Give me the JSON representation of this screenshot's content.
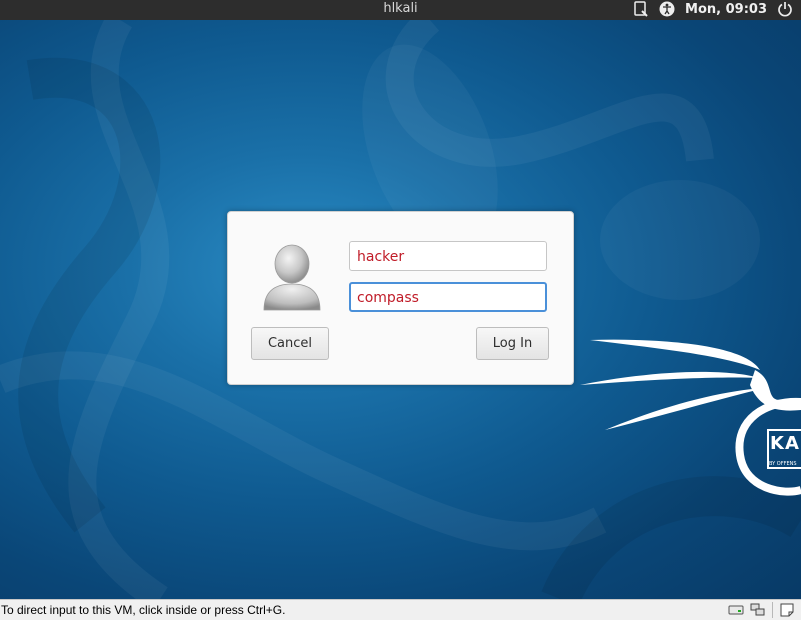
{
  "topbar": {
    "hostname": "hlkali",
    "clock": "Mon, 09:03",
    "icons": [
      "screen-reader-icon",
      "accessibility-icon",
      "power-icon"
    ]
  },
  "login": {
    "username_value": "hacker",
    "password_value": "compass",
    "cancel_label": "Cancel",
    "login_label": "Log In",
    "avatar_icon": "user-avatar-icon",
    "text_color": "#c01c28",
    "focus_color": "#4a90d9"
  },
  "wallpaper": {
    "logo_text": "KA",
    "logo_subtext": "BY OFFENS"
  },
  "statusbar": {
    "message": "To direct input to this VM, click inside or press Ctrl+G.",
    "icons": [
      "hard-disk-icon",
      "network-icon",
      "notes-icon"
    ]
  }
}
